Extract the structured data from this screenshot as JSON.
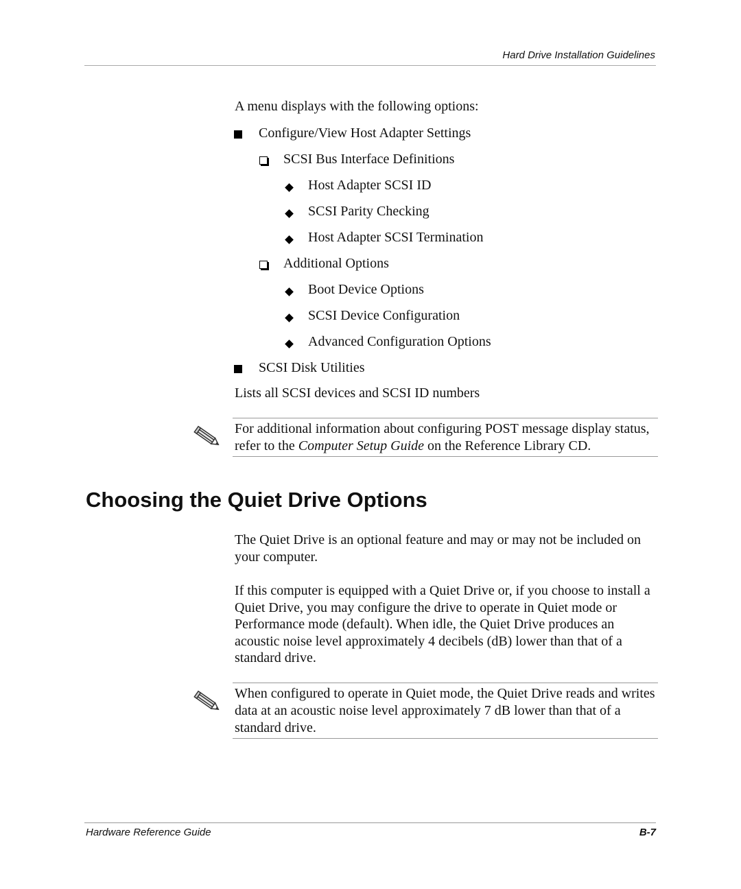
{
  "header": {
    "title": "Hard Drive Installation Guidelines"
  },
  "intro": "A menu displays with the following options:",
  "menu": [
    {
      "level": 1,
      "bullet": "square",
      "label": "Configure/View Host Adapter Settings"
    },
    {
      "level": 2,
      "bullet": "box",
      "label": "SCSI Bus Interface Definitions"
    },
    {
      "level": 3,
      "bullet": "diamond",
      "label": "Host Adapter SCSI ID"
    },
    {
      "level": 3,
      "bullet": "diamond",
      "label": "SCSI Parity Checking"
    },
    {
      "level": 3,
      "bullet": "diamond",
      "label": "Host Adapter SCSI Termination"
    },
    {
      "level": 2,
      "bullet": "box",
      "label": "Additional Options"
    },
    {
      "level": 3,
      "bullet": "diamond",
      "label": "Boot Device Options"
    },
    {
      "level": 3,
      "bullet": "diamond",
      "label": "SCSI Device Configuration"
    },
    {
      "level": 3,
      "bullet": "diamond",
      "label": "Advanced Configuration Options"
    },
    {
      "level": 1,
      "bullet": "square",
      "label": "SCSI Disk Utilities"
    }
  ],
  "disk_utilities_desc": "Lists all SCSI devices and SCSI ID numbers",
  "note1": {
    "icon": "pencil-note-icon",
    "before": "For additional information about configuring POST message display status, refer to the ",
    "italic": "Computer Setup Guide",
    "after": " on the Reference Library CD."
  },
  "section": {
    "heading": "Choosing the Quiet Drive Options",
    "para1": "The Quiet Drive is an optional feature and may or may not be included on your computer.",
    "para2": "If this computer is equipped with a Quiet Drive or, if you choose to install a Quiet Drive, you may configure the drive to operate in Quiet mode or Performance mode (default). When idle, the Quiet Drive produces an acoustic noise level approximately 4 decibels (dB) lower than that of a standard drive."
  },
  "note2": {
    "icon": "pencil-note-icon",
    "text": "When configured to operate in Quiet mode, the Quiet Drive reads and writes data at an acoustic noise level approximately 7 dB lower than that of a standard drive."
  },
  "footer": {
    "left": "Hardware Reference Guide",
    "page": "B-7"
  }
}
